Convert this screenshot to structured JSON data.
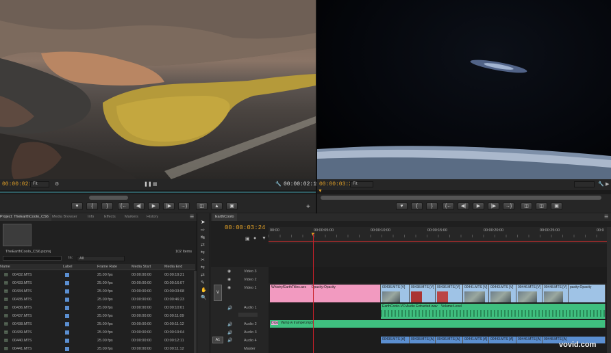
{
  "source_monitor": {
    "timecode_in": "00:00:02:11",
    "fit_label": "Fit",
    "timecode_out": "00:00:02:19"
  },
  "program_monitor": {
    "timecode_in": "00:00:03:24",
    "fit_label": "Fit"
  },
  "project_panel": {
    "tabs": [
      "Project: TheEarthCoolo_CS6",
      "Media Browser",
      "Info",
      "Effects",
      "Markers",
      "History"
    ],
    "project_file": "TheEarthCoolo_CS6.prproj",
    "item_count": "102 Items",
    "search_in_label": "In:",
    "search_in_value": "All",
    "columns": {
      "name": "Name",
      "label": "Label",
      "frame_rate": "Frame Rate",
      "media_start": "Media Start",
      "media_end": "Media End"
    },
    "rows": [
      {
        "name": "00432.MTS",
        "frame_rate": "25.00 fps",
        "media_start": "00:00:00:00",
        "media_end": "00:00:19:21"
      },
      {
        "name": "00433.MTS",
        "frame_rate": "25.00 fps",
        "media_start": "00:00:00:00",
        "media_end": "00:00:16:07"
      },
      {
        "name": "00434.MTS",
        "frame_rate": "25.00 fps",
        "media_start": "00:00:00:00",
        "media_end": "00:00:03:08"
      },
      {
        "name": "00435.MTS",
        "frame_rate": "25.00 fps",
        "media_start": "00:00:00:00",
        "media_end": "00:00:46:23"
      },
      {
        "name": "00436.MTS",
        "frame_rate": "25.00 fps",
        "media_start": "00:00:00:00",
        "media_end": "00:00:10:01"
      },
      {
        "name": "00437.MTS",
        "frame_rate": "25.00 fps",
        "media_start": "00:00:00:00",
        "media_end": "00:00:11:09"
      },
      {
        "name": "00438.MTS",
        "frame_rate": "25.00 fps",
        "media_start": "00:00:00:00",
        "media_end": "00:00:11:12"
      },
      {
        "name": "00439.MTS",
        "frame_rate": "25.00 fps",
        "media_start": "00:00:00:00",
        "media_end": "00:00:19:04"
      },
      {
        "name": "00440.MTS",
        "frame_rate": "25.00 fps",
        "media_start": "00:00:00:00",
        "media_end": "00:00:12:11"
      },
      {
        "name": "00441.MTS",
        "frame_rate": "25.00 fps",
        "media_start": "00:00:00:00",
        "media_end": "00:00:11:12"
      }
    ]
  },
  "timeline": {
    "tab": "EarthCoolo",
    "current_time": "00:00:03:24",
    "ruler_ticks": [
      "00:00",
      "00:00:05:00",
      "00:00:10:00",
      "00:00:15:00",
      "00:00:20:00",
      "00:00:25:00",
      "00:0"
    ],
    "tracks": {
      "video3": "Video 3",
      "video2": "Video 2",
      "video1": "Video 1",
      "audio1": "Audio 1",
      "audio2": "Audio 2",
      "audio3": "Audio 3",
      "audio4": "Audio 4",
      "master": "Master",
      "v_target": "V",
      "a_target": "A1"
    },
    "clips": {
      "title_clip": "Whistry/EarthTitles.aec",
      "title_opacity": "Opacity:Opacity",
      "v_clip1": "00436.MTS [V]",
      "v_clip2": "00438.MTS [V]",
      "v_clip3": "00436.MTS [V]",
      "v_clip4": "00441.MTS [V]",
      "v_clip5": "00443.MTS [V]",
      "v_clip6": "00446.MTS [V]",
      "v_clip7": "00448.MTS [V]",
      "v_clip_end": "pacity:Opacity",
      "audio1_clip": "EarthCoolo-VO Audio Extracted.wav",
      "audio1_level": "Volume:Level",
      "audio2_prefix": "Dipp",
      "audio2_clip": "Vamp w trumpet.mp3",
      "a4_clip1": "00436.MTS [A]",
      "a4_clip2": "00438.MTS [A]",
      "a4_clip3": "00436.MTS [A]",
      "a4_clip4": "00441.MTS [A]",
      "a4_clip5": "00443.MTS [A]",
      "a4_clip6": "00446.MTS [A]",
      "a4_clip7": "00448.MTS [A]"
    }
  },
  "watermark": "vovid.com",
  "colors": {
    "timecode": "#e2a128",
    "title_clip": "#f29ac0",
    "video_clip": "#9fc3e6",
    "audio_clip": "#3fbf7f",
    "playhead": "#c8202a",
    "label_swatch": "#5b8fd1"
  }
}
